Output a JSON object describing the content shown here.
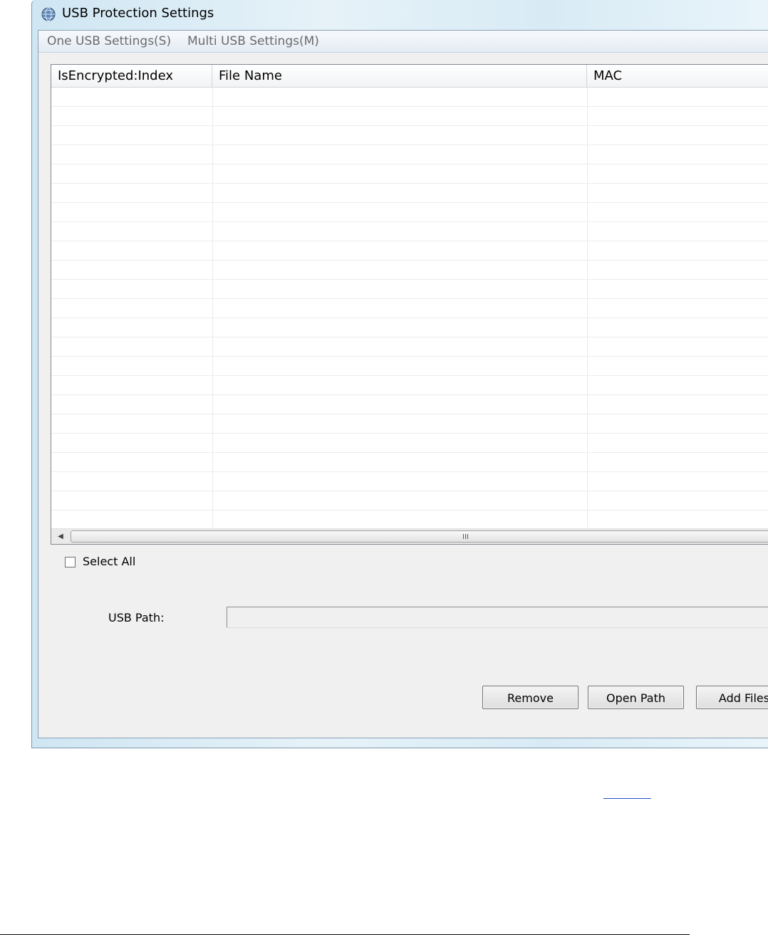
{
  "window": {
    "title": "USB Protection Settings"
  },
  "menu": {
    "items": [
      {
        "label": "One USB Settings(S)"
      },
      {
        "label": "Multi USB Settings(M)"
      }
    ]
  },
  "file_list": {
    "columns": [
      "IsEncrypted:Index",
      "File Name",
      "MAC"
    ],
    "rows": []
  },
  "scrollbar": {
    "grip": "III"
  },
  "select_all": {
    "label": "Select All",
    "checked": false
  },
  "usb_path": {
    "label": "USB Path:",
    "value": ""
  },
  "buttons": {
    "remove": "Remove",
    "open_path": "Open Path",
    "add_files": "Add Files"
  }
}
